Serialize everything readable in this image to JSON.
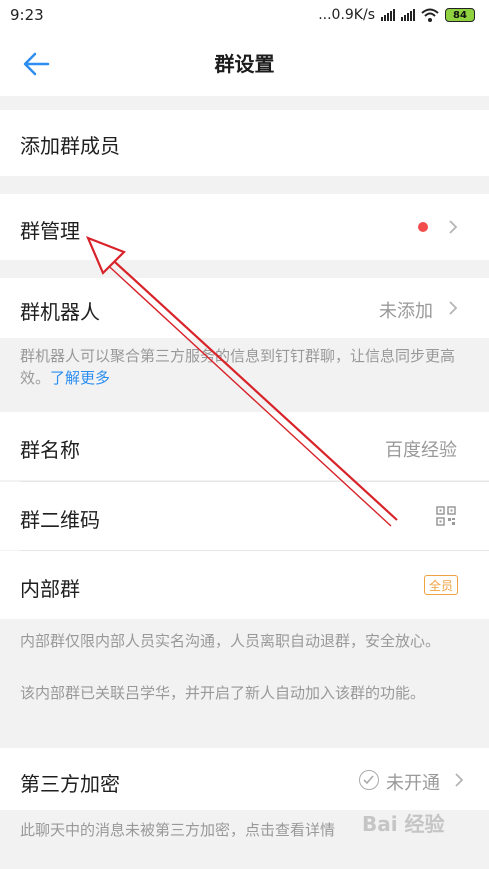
{
  "status_bar": {
    "time": "9:23",
    "network_speed": "...0.9K/s",
    "battery": "84"
  },
  "nav": {
    "title": "群设置"
  },
  "rows": {
    "add_member": {
      "label": "添加群成员"
    },
    "group_manage": {
      "label": "群管理"
    },
    "group_robot": {
      "label": "群机器人",
      "value": "未添加"
    },
    "group_name": {
      "label": "群名称",
      "value": "百度经验"
    },
    "group_qr": {
      "label": "群二维码"
    },
    "internal_group": {
      "label": "内部群",
      "badge": "全员"
    },
    "third_party_encrypt": {
      "label": "第三方加密",
      "value": "未开通"
    }
  },
  "notes": {
    "robot_desc": "群机器人可以聚合第三方服务的信息到钉钉群聊，让信息同步更高效。",
    "robot_link": "了解更多",
    "internal_desc_1": "内部群仅限内部人员实名沟通，人员离职自动退群，安全放心。",
    "internal_desc_2": "该内部群已关联吕学华，并开启了新人自动加入该群的功能。",
    "encrypt_desc": "此聊天中的消息未被第三方加密，点击查看详情"
  },
  "watermark": "Bai 经验",
  "colors": {
    "accent_blue": "#2b8ef0",
    "red_dot": "#f24c4c",
    "badge_orange": "#f0a140",
    "annotation_arrow": "#d8232a"
  }
}
